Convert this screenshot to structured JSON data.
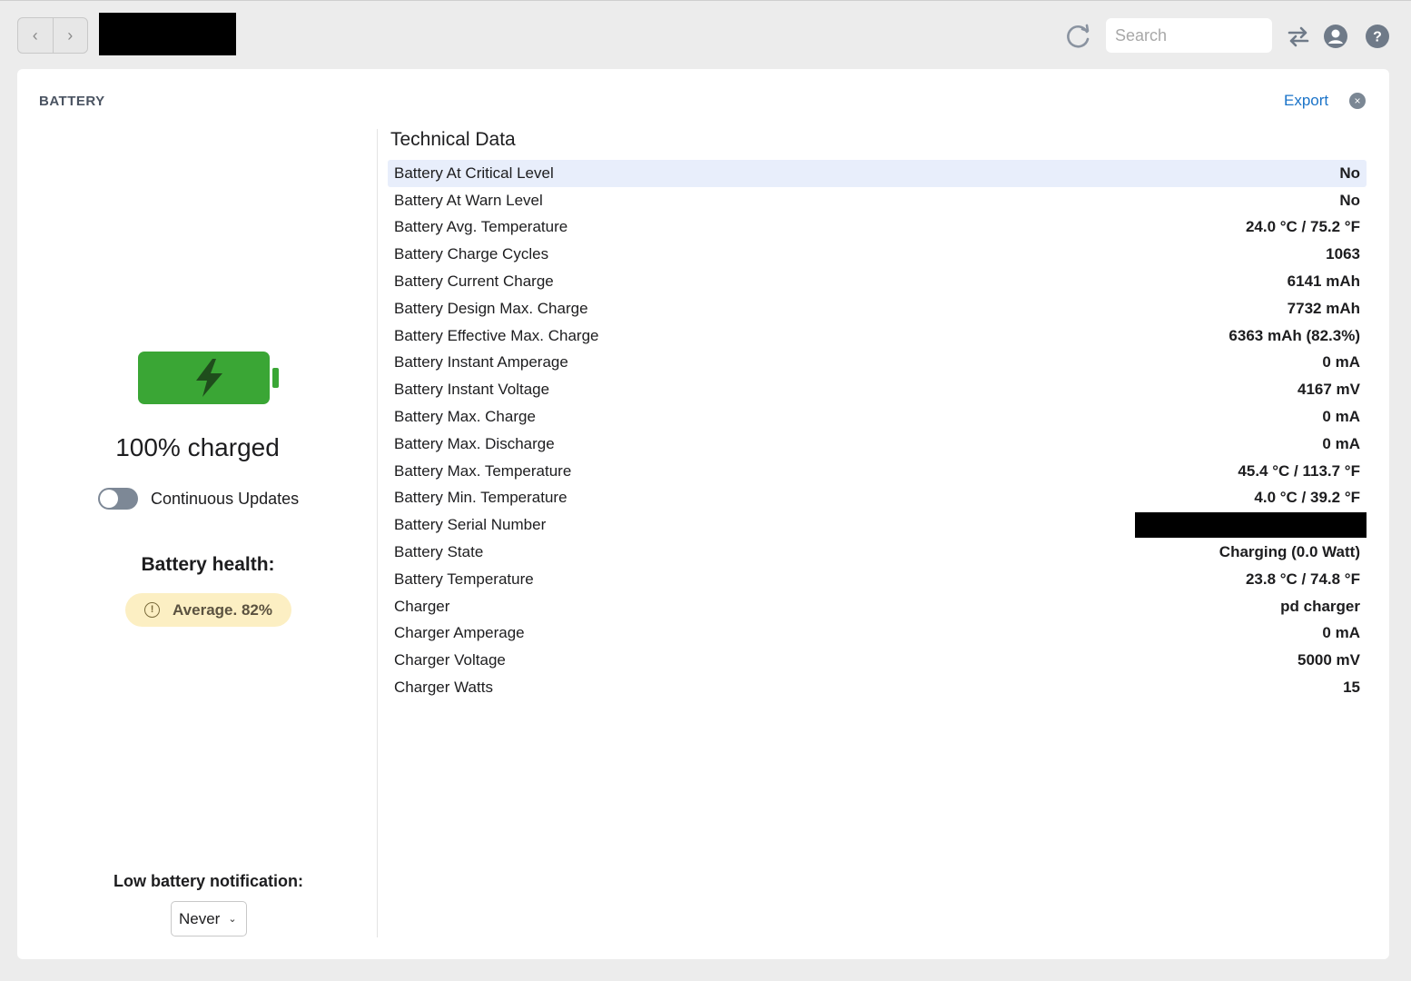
{
  "toolbar": {
    "back_label": "‹",
    "forward_label": "›",
    "search_placeholder": "Search",
    "icons": [
      "refresh-icon",
      "transfer-icon",
      "account-icon",
      "help-icon"
    ]
  },
  "card": {
    "title": "BATTERY",
    "export_label": "Export",
    "close_label": "×"
  },
  "battery": {
    "level_percent": 100,
    "charged_text": "100% charged",
    "fill_color": "#3aa635",
    "continuous_updates_label": "Continuous Updates",
    "continuous_updates_on": false,
    "health_label": "Battery health:",
    "health_icon": "!",
    "health_value": "Average. 82%",
    "notification_label": "Low battery notification:",
    "notification_value": "Never",
    "notification_chevron": "⌄"
  },
  "technical": {
    "title": "Technical Data",
    "rows": [
      {
        "key": "Battery At Critical Level",
        "value": "No"
      },
      {
        "key": "Battery At Warn Level",
        "value": "No"
      },
      {
        "key": "Battery Avg. Temperature",
        "value": "24.0 °C / 75.2 °F"
      },
      {
        "key": "Battery Charge Cycles",
        "value": "1063"
      },
      {
        "key": "Battery Current Charge",
        "value": "6141 mAh"
      },
      {
        "key": "Battery Design Max. Charge",
        "value": "7732 mAh"
      },
      {
        "key": "Battery Effective Max. Charge",
        "value": "6363 mAh (82.3%)"
      },
      {
        "key": "Battery Instant Amperage",
        "value": "0 mA"
      },
      {
        "key": "Battery Instant Voltage",
        "value": "4167 mV"
      },
      {
        "key": "Battery Max. Charge",
        "value": "0 mA"
      },
      {
        "key": "Battery Max. Discharge",
        "value": "0 mA"
      },
      {
        "key": "Battery Max. Temperature",
        "value": "45.4 °C / 113.7 °F"
      },
      {
        "key": "Battery Min. Temperature",
        "value": "4.0 °C / 39.2 °F"
      },
      {
        "key": "Battery Serial Number",
        "value": ""
      },
      {
        "key": "Battery State",
        "value": "Charging (0.0 Watt)"
      },
      {
        "key": "Battery Temperature",
        "value": "23.8 °C / 74.8 °F"
      },
      {
        "key": "Charger",
        "value": "pd charger"
      },
      {
        "key": "Charger Amperage",
        "value": "0 mA"
      },
      {
        "key": "Charger Voltage",
        "value": "5000 mV"
      },
      {
        "key": "Charger Watts",
        "value": "15"
      }
    ]
  }
}
